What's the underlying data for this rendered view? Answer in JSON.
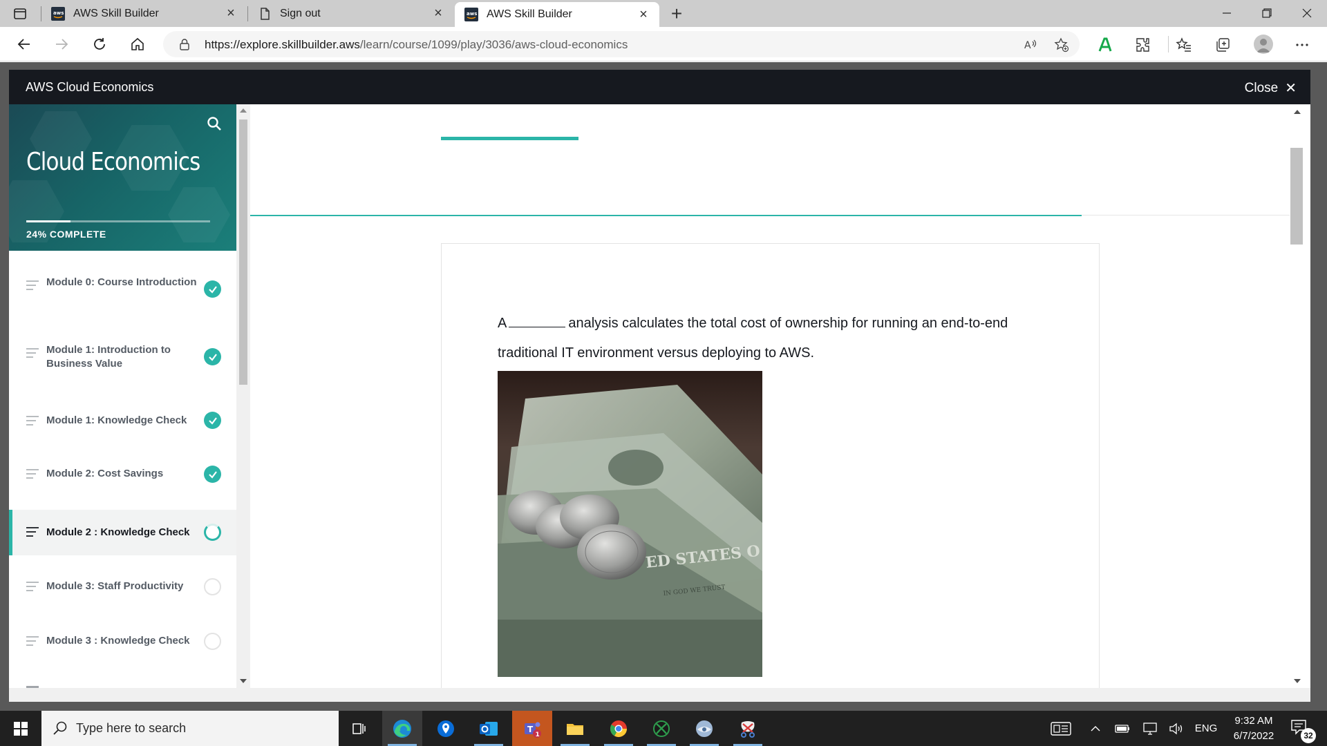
{
  "browser": {
    "tabs": [
      {
        "title": "AWS Skill Builder",
        "favicon": "aws-icon",
        "active": false
      },
      {
        "title": "Sign out",
        "favicon": "page-icon",
        "active": false
      },
      {
        "title": "AWS Skill Builder",
        "favicon": "aws-icon",
        "active": true
      }
    ],
    "url_host": "https://explore.skillbuilder.aws",
    "url_path": "/learn/course/1099/play/3036/aws-cloud-economics"
  },
  "course": {
    "header_title": "AWS Cloud Economics",
    "close_label": "Close",
    "title": "Cloud Economics",
    "progress_percent": 24,
    "progress_label": "24% COMPLETE"
  },
  "modules": [
    {
      "label": "Module 0: Course Introduction",
      "status": "done"
    },
    {
      "label": "Module 1: Introduction to Business Value",
      "status": "done"
    },
    {
      "label": "Module 1: Knowledge Check",
      "status": "done"
    },
    {
      "label": "Module 2: Cost Savings",
      "status": "done"
    },
    {
      "label": "Module 2 : Knowledge Check",
      "status": "in-progress"
    },
    {
      "label": "Module 3: Staff Productivity",
      "status": "todo"
    },
    {
      "label": "Module 3 : Knowledge Check",
      "status": "todo"
    }
  ],
  "question": {
    "before_blank": "A",
    "after_blank": "analysis calculates the total cost of ownership for running an end-to-end traditional IT environment versus deploying to AWS."
  },
  "taskbar": {
    "search_placeholder": "Type here to search",
    "language": "ENG",
    "time": "9:32 AM",
    "date": "6/7/2022",
    "notification_count": "32",
    "teams_badge": "1"
  },
  "colors": {
    "accent": "#2bb5a8",
    "header_bg": "#16191f"
  }
}
